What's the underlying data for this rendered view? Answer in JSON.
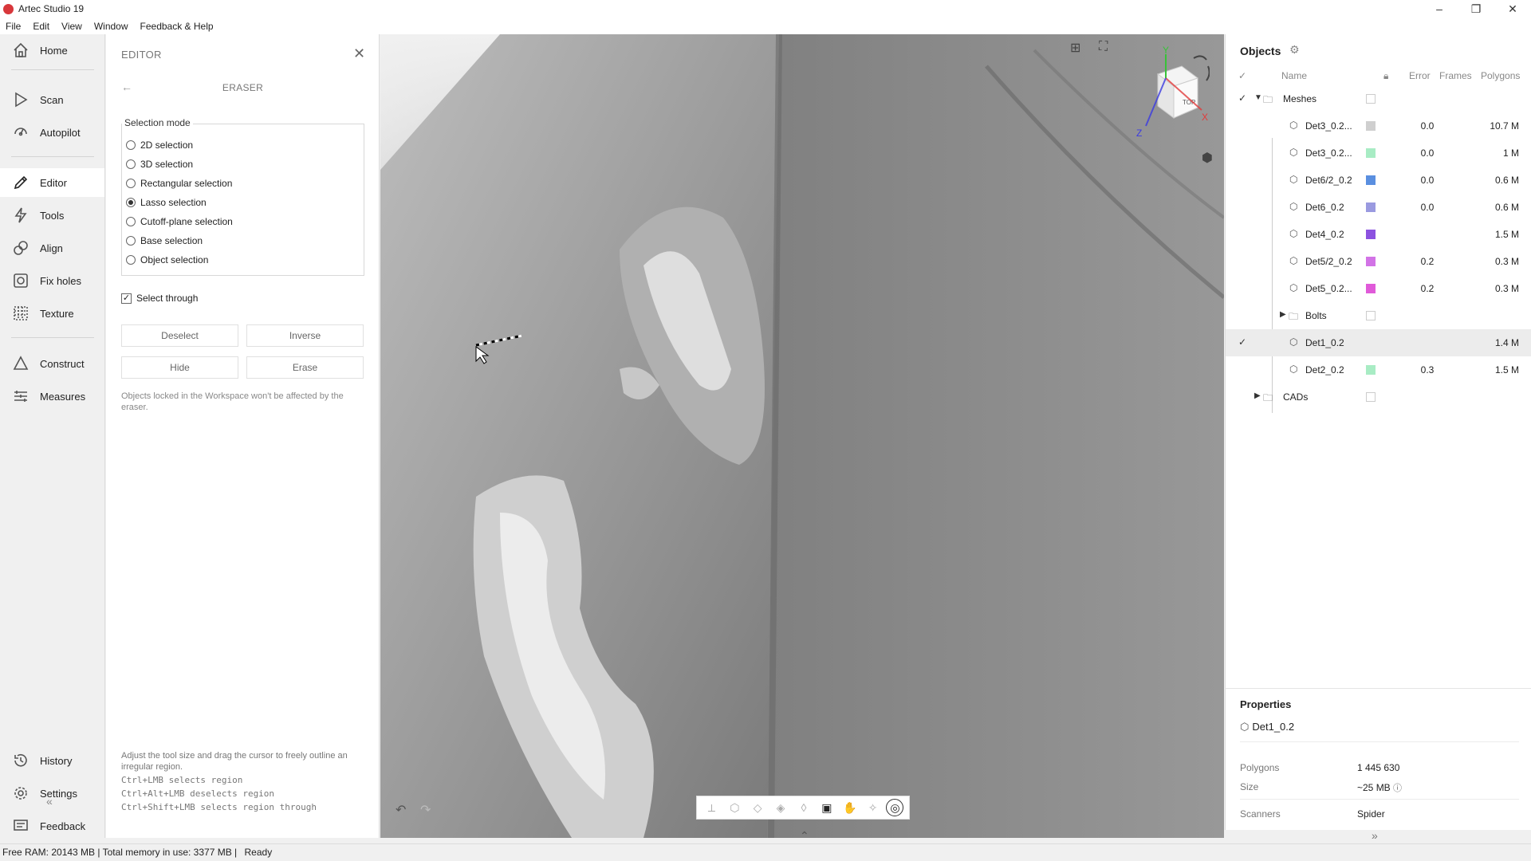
{
  "window": {
    "title": "Artec Studio 19",
    "controls": [
      "–",
      "❐",
      "✕"
    ]
  },
  "menu": [
    "File",
    "Edit",
    "View",
    "Window",
    "Feedback & Help"
  ],
  "sidebar": {
    "items": [
      {
        "label": "Home",
        "icon": "home-icon"
      },
      {
        "label": "Scan",
        "icon": "scan-icon"
      },
      {
        "label": "Autopilot",
        "icon": "autopilot-icon"
      },
      {
        "label": "Editor",
        "icon": "pencil-icon",
        "active": true
      },
      {
        "label": "Tools",
        "icon": "lightning-icon"
      },
      {
        "label": "Align",
        "icon": "align-icon"
      },
      {
        "label": "Fix holes",
        "icon": "fix-holes-icon"
      },
      {
        "label": "Texture",
        "icon": "texture-icon"
      },
      {
        "label": "Construct",
        "icon": "triangle-icon"
      },
      {
        "label": "Measures",
        "icon": "measures-icon"
      },
      {
        "label": "History",
        "icon": "history-icon"
      },
      {
        "label": "Settings",
        "icon": "gear-icon"
      },
      {
        "label": "Feedback",
        "icon": "feedback-icon"
      }
    ],
    "collapse": "«"
  },
  "editor": {
    "title": "EDITOR",
    "close": "✕",
    "back": "←",
    "tool_title": "ERASER",
    "selection_mode_label": "Selection mode",
    "modes": [
      {
        "label": "2D selection",
        "selected": false
      },
      {
        "label": "3D selection",
        "selected": false
      },
      {
        "label": "Rectangular selection",
        "selected": false
      },
      {
        "label": "Lasso selection",
        "selected": true
      },
      {
        "label": "Cutoff-plane selection",
        "selected": false
      },
      {
        "label": "Base selection",
        "selected": false
      },
      {
        "label": "Object selection",
        "selected": false
      }
    ],
    "select_through": {
      "label": "Select through",
      "checked": true
    },
    "buttons": {
      "deselect": "Deselect",
      "inverse": "Inverse",
      "hide": "Hide",
      "erase": "Erase"
    },
    "lock_note": "Objects locked in the Workspace won't be affected by the eraser.",
    "help": {
      "line1": "Adjust the tool size and drag the cursor to freely outline an irregular region.",
      "line2": "Ctrl+LMB selects region",
      "line3": "Ctrl+Alt+LMB deselects region",
      "line4": "Ctrl+Shift+LMB selects region through"
    }
  },
  "viewport": {
    "cube_face": "TOP",
    "axes": {
      "x": "X",
      "y": "Y",
      "z": "Z"
    },
    "undo": "↶",
    "redo": "↷",
    "collapse": "⌃"
  },
  "objects": {
    "title": "Objects",
    "columns": {
      "name": "Name",
      "error": "Error",
      "frames": "Frames",
      "polygons": "Polygons"
    },
    "groups": {
      "meshes": "Meshes",
      "bolts": "Bolts",
      "cads": "CADs"
    },
    "rows": [
      {
        "name": "Det3_0.2...",
        "color": "#cfcfcf",
        "error": "0.0",
        "polygons": "10.7 M"
      },
      {
        "name": "Det3_0.2...",
        "color": "#a8ecc4",
        "error": "0.0",
        "polygons": "1 M"
      },
      {
        "name": "Det6/2_0.2",
        "color": "#5a8fe0",
        "error": "0.0",
        "polygons": "0.6 M"
      },
      {
        "name": "Det6_0.2",
        "color": "#9a9ae0",
        "error": "0.0",
        "polygons": "0.6 M"
      },
      {
        "name": "Det4_0.2",
        "color": "#8c52e0",
        "error": "",
        "polygons": "1.5 M"
      },
      {
        "name": "Det5/2_0.2",
        "color": "#d273e6",
        "error": "0.2",
        "polygons": "0.3 M"
      },
      {
        "name": "Det5_0.2...",
        "color": "#e05ad9",
        "error": "0.2",
        "polygons": "0.3 M"
      },
      {
        "name": "Det1_0.2",
        "color": "#ffffff",
        "error": "",
        "polygons": "1.4 M",
        "selected": true
      },
      {
        "name": "Det2_0.2",
        "color": "#a8ecc4",
        "error": "0.3",
        "polygons": "1.5 M"
      }
    ]
  },
  "properties": {
    "title": "Properties",
    "object": "Det1_0.2",
    "polygons_label": "Polygons",
    "polygons": "1 445 630",
    "size_label": "Size",
    "size": "~25 MB",
    "scanners_label": "Scanners",
    "scanners": "Spider",
    "collapse": "»"
  },
  "status": {
    "free_ram": "Free RAM: 20143 MB",
    "total_mem": "Total memory in use: 3377 MB",
    "state": "Ready"
  }
}
